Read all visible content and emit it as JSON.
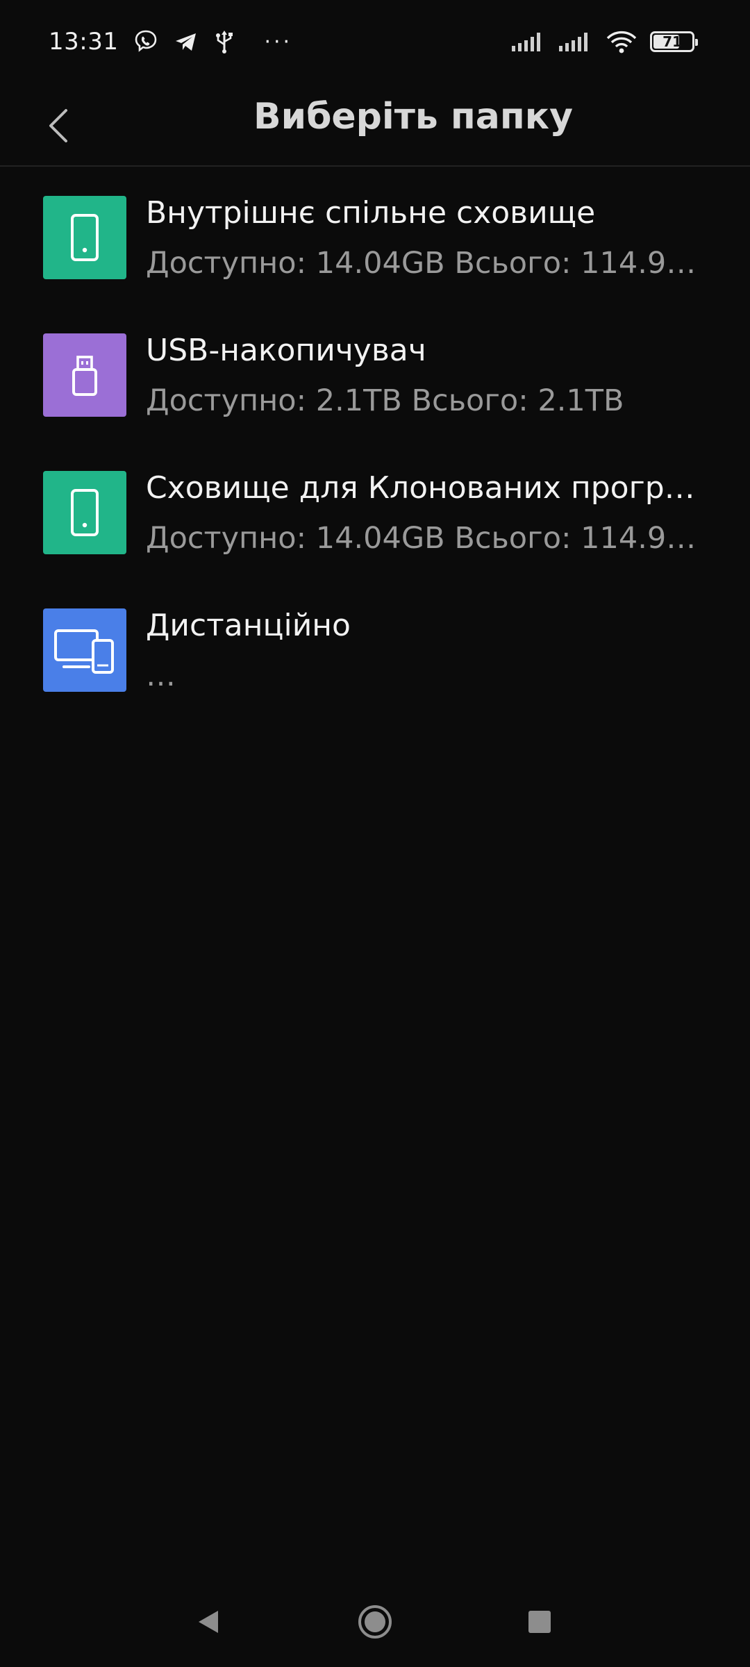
{
  "status_bar": {
    "time": "13:31",
    "overflow_dots": "···",
    "battery_level": "71",
    "battery_fraction": 0.71
  },
  "header": {
    "title": "Виберіть папку"
  },
  "storage_items": [
    {
      "title": "Внутрішнє спільне сховище",
      "subtitle": "Доступно: 14.04GB Всього: 114.9…",
      "icon": "phone-icon",
      "color": "#21b589"
    },
    {
      "title": "USB-накопичувач",
      "subtitle": "Доступно: 2.1TB Всього: 2.1TB",
      "icon": "usb-drive-icon",
      "color": "#9b6fd6"
    },
    {
      "title": "Сховище для Клонованих прогр…",
      "subtitle": "Доступно: 14.04GB Всього: 114.9…",
      "icon": "phone-icon",
      "color": "#21b589"
    },
    {
      "title": "Дистанційно",
      "subtitle": "…",
      "icon": "devices-icon",
      "color": "#4a7fe8"
    }
  ],
  "colors": {
    "background": "#0b0b0b",
    "title_text": "#f2f2f2",
    "subtitle_text": "#9a9a9a"
  }
}
